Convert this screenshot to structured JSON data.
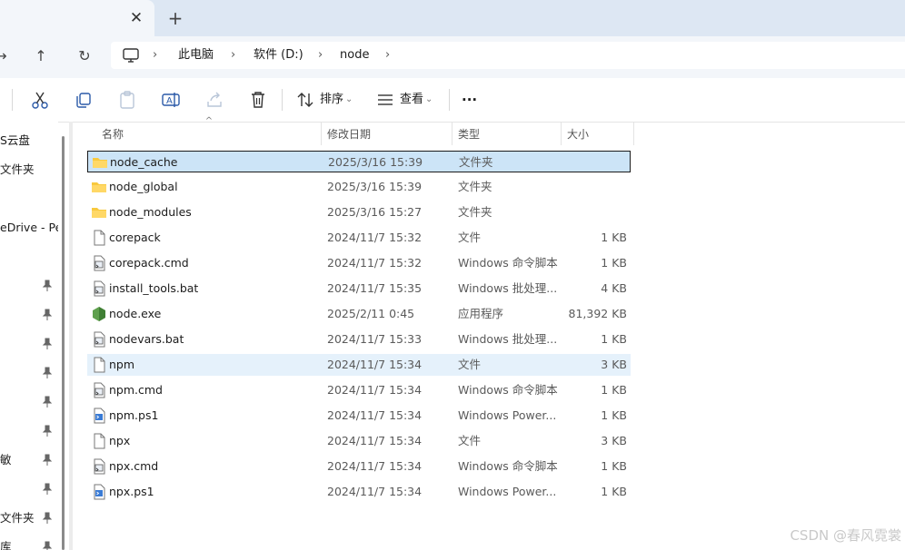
{
  "tabbar": {
    "close_glyph": "✕",
    "new_tab_glyph": "+"
  },
  "nav": {
    "forward_glyph": "→",
    "up_glyph": "↑",
    "refresh_glyph": "↻"
  },
  "breadcrumb": {
    "items": [
      "此电脑",
      "软件 (D:)",
      "node"
    ],
    "separator": "›"
  },
  "toolbar": {
    "sort_label": "排序",
    "view_label": "查看",
    "more_label": "···",
    "dropdown_glyph": "⌄"
  },
  "navpane": {
    "items": [
      {
        "label": "S云盘",
        "pinned": false
      },
      {
        "label": "文件夹",
        "pinned": false
      },
      {
        "label": "",
        "pinned": false
      },
      {
        "label": "eDrive - Per",
        "pinned": false
      },
      {
        "label": "",
        "pinned": true
      },
      {
        "label": "",
        "pinned": true
      },
      {
        "label": "",
        "pinned": true
      },
      {
        "label": "",
        "pinned": true
      },
      {
        "label": "",
        "pinned": true
      },
      {
        "label": "",
        "pinned": true
      },
      {
        "label": "敏",
        "pinned": true
      },
      {
        "label": "",
        "pinned": true
      },
      {
        "label": "文件夹",
        "pinned": true
      },
      {
        "label": "库",
        "pinned": true
      }
    ],
    "pin_glyph": "📌"
  },
  "columns": {
    "name": "名称",
    "date": "修改日期",
    "type": "类型",
    "size": "大小",
    "sort_glyph": "^"
  },
  "files": [
    {
      "name": "node_cache",
      "date": "2025/3/16 15:39",
      "type": "文件夹",
      "size": "",
      "icon": "folder-icon",
      "state": "selected"
    },
    {
      "name": "node_global",
      "date": "2025/3/16 15:39",
      "type": "文件夹",
      "size": "",
      "icon": "folder-icon",
      "state": ""
    },
    {
      "name": "node_modules",
      "date": "2025/3/16 15:27",
      "type": "文件夹",
      "size": "",
      "icon": "folder-icon",
      "state": ""
    },
    {
      "name": "corepack",
      "date": "2024/11/7 15:32",
      "type": "文件",
      "size": "1 KB",
      "icon": "file-icon",
      "state": ""
    },
    {
      "name": "corepack.cmd",
      "date": "2024/11/7 15:32",
      "type": "Windows 命令脚本",
      "size": "1 KB",
      "icon": "script-icon",
      "state": ""
    },
    {
      "name": "install_tools.bat",
      "date": "2024/11/7 15:35",
      "type": "Windows 批处理...",
      "size": "4 KB",
      "icon": "script-icon",
      "state": ""
    },
    {
      "name": "node.exe",
      "date": "2025/2/11 0:45",
      "type": "应用程序",
      "size": "81,392 KB",
      "icon": "node-exe-icon",
      "state": ""
    },
    {
      "name": "nodevars.bat",
      "date": "2024/11/7 15:33",
      "type": "Windows 批处理...",
      "size": "1 KB",
      "icon": "script-icon",
      "state": ""
    },
    {
      "name": "npm",
      "date": "2024/11/7 15:34",
      "type": "文件",
      "size": "3 KB",
      "icon": "file-icon",
      "state": "hover"
    },
    {
      "name": "npm.cmd",
      "date": "2024/11/7 15:34",
      "type": "Windows 命令脚本",
      "size": "1 KB",
      "icon": "script-icon",
      "state": ""
    },
    {
      "name": "npm.ps1",
      "date": "2024/11/7 15:34",
      "type": "Windows Power...",
      "size": "1 KB",
      "icon": "powershell-icon",
      "state": ""
    },
    {
      "name": "npx",
      "date": "2024/11/7 15:34",
      "type": "文件",
      "size": "3 KB",
      "icon": "file-icon",
      "state": ""
    },
    {
      "name": "npx.cmd",
      "date": "2024/11/7 15:34",
      "type": "Windows 命令脚本",
      "size": "1 KB",
      "icon": "script-icon",
      "state": ""
    },
    {
      "name": "npx.ps1",
      "date": "2024/11/7 15:34",
      "type": "Windows Power...",
      "size": "1 KB",
      "icon": "powershell-icon",
      "state": ""
    }
  ],
  "watermark": "CSDN @春风霓裳",
  "colors": {
    "selection": "#cce4f7",
    "hover": "#e5f1fb",
    "folder": "#f8c93e",
    "node": "#5fa04e"
  }
}
